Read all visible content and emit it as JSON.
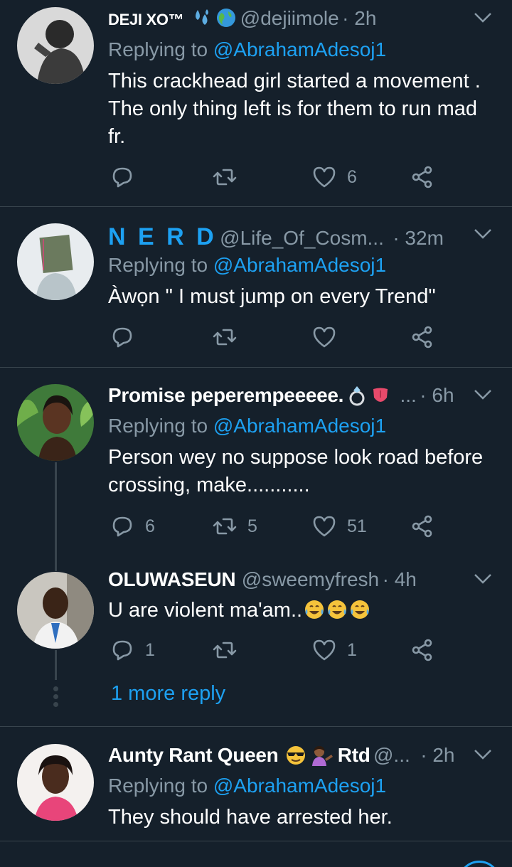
{
  "tweets": [
    {
      "name": "DEJI XO™",
      "name_emojis": [
        "sweat-droplets",
        "globe"
      ],
      "handle": "@dejiimole",
      "time": "· 2h",
      "replying_label": "Replying to ",
      "replying_to": "@AbrahamAdesoj1",
      "lines": [
        "This crackhead girl started a movement .",
        "The only thing left is for them to run mad",
        "fr."
      ],
      "likes": "6"
    },
    {
      "name": "N E R D",
      "handle": "@Life_Of_Cosm...",
      "time": "· 32m",
      "replying_label": "Replying to ",
      "replying_to": "@AbrahamAdesoj1",
      "lines": [
        "Àwọn \" I must jump on every Trend\""
      ]
    },
    {
      "name": "Promise peperempeeeee.",
      "name_emojis": [
        "ring",
        "tongue"
      ],
      "handle": "...",
      "time": "· 6h",
      "replying_label": "Replying to ",
      "replying_to": "@AbrahamAdesoj1",
      "lines": [
        "Person wey no suppose look road before",
        "crossing, make..........."
      ],
      "replies": "6",
      "retweets": "5",
      "likes": "51"
    },
    {
      "name": "OLUWASEUN",
      "handle": "@sweemyfresh",
      "time": "· 4h",
      "lines": [
        "U are violent ma'am.."
      ],
      "text_emojis": [
        "tears-of-joy",
        "tears-of-joy",
        "tears-of-joy"
      ],
      "replies": "1",
      "likes": "1"
    },
    {
      "name": "Aunty Rant Queen",
      "name_emojis": [
        "sunglasses",
        "tipping-hand"
      ],
      "name_suffix": "Rtd",
      "handle": "@...",
      "time": "· 2h",
      "replying_label": "Replying to ",
      "replying_to": "@AbrahamAdesoj1",
      "lines": [
        "They should have arrested her."
      ]
    }
  ],
  "more_replies": "1 more reply",
  "icons": {
    "reply": "reply-icon",
    "retweet": "retweet-icon",
    "like": "heart-icon",
    "share": "share-icon",
    "menu": "chevron-down-icon"
  },
  "colors": {
    "background": "#15202b",
    "divider": "#38444d",
    "secondary_text": "#8899a6",
    "link": "#1da1f2",
    "nerd_name": "#1da1f2"
  }
}
